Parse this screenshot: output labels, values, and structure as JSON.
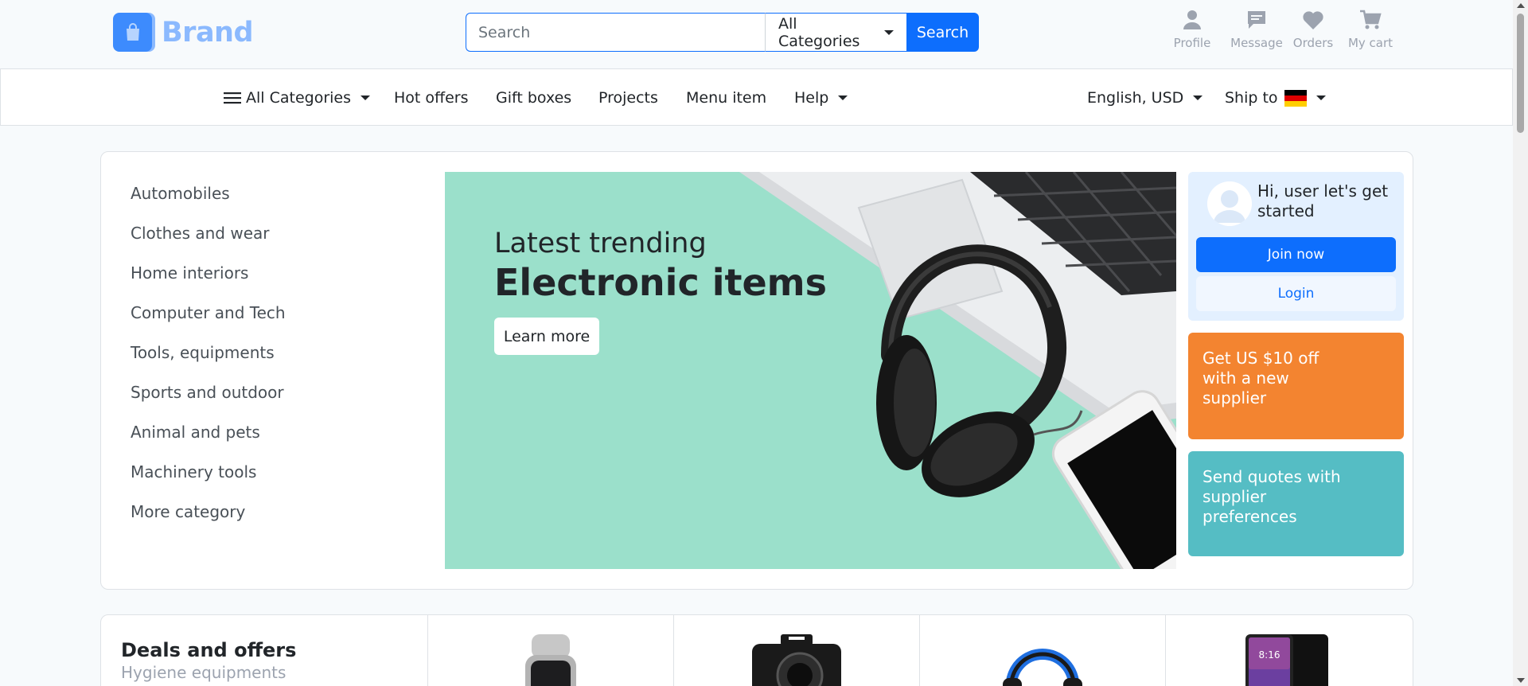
{
  "brand": {
    "name": "Brand",
    "icon": "shopping-bag-icon"
  },
  "search": {
    "placeholder": "Search",
    "category": "All Categories",
    "button": "Search"
  },
  "top_actions": [
    {
      "label": "Profile",
      "icon": "person-icon"
    },
    {
      "label": "Message",
      "icon": "message-icon"
    },
    {
      "label": "Orders",
      "icon": "heart-icon"
    },
    {
      "label": "My cart",
      "icon": "cart-icon"
    }
  ],
  "nav": {
    "all_categories": "All Categories",
    "items": [
      "Hot offers",
      "Gift boxes",
      "Projects",
      "Menu item",
      "Help"
    ],
    "language": "English, USD",
    "ship_to": "Ship to"
  },
  "categories": [
    "Automobiles",
    "Clothes and wear",
    "Home interiors",
    "Computer and Tech",
    "Tools, equipments",
    "Sports and outdoor",
    "Animal and pets",
    "Machinery tools",
    "More category"
  ],
  "banner": {
    "line1": "Latest trending",
    "line2": "Electronic items",
    "button": "Learn more"
  },
  "user_box": {
    "greeting": "Hi, user let's get started",
    "join": "Join now",
    "login": "Login"
  },
  "promos": [
    {
      "text": "Get US $10 off with a new supplier",
      "color": "#f38430"
    },
    {
      "text": "Send quotes with supplier preferences",
      "color": "#55bdc4"
    }
  ],
  "deals": {
    "title": "Deals and offers",
    "subtitle": "Hygiene equipments",
    "products": [
      "smartwatch-image",
      "camera-image",
      "headphones-image",
      "smartphone-image"
    ],
    "phone_screen_time": "8:16"
  },
  "colors": {
    "primary": "#0d6efd",
    "brand_light": "#8bb9fe",
    "banner_bg": "#9be0cb"
  }
}
